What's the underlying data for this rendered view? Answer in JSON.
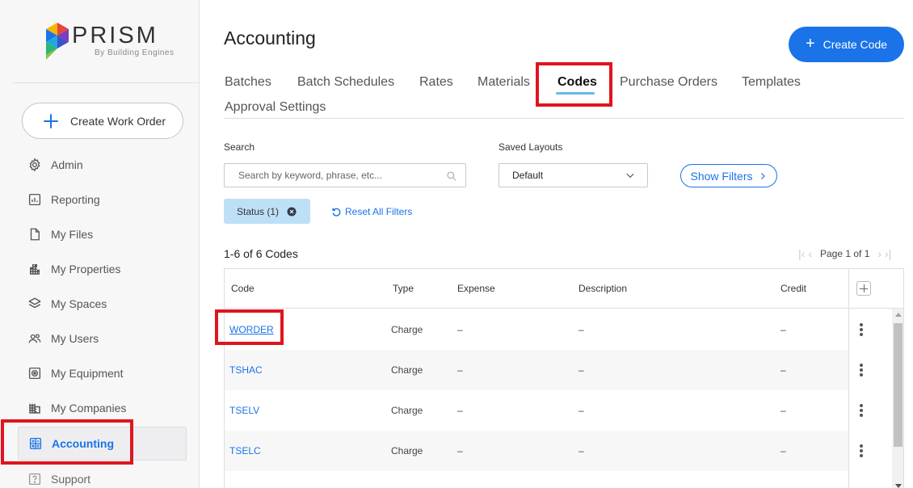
{
  "brand": {
    "name": "PRISM",
    "sub": "By Building Engines"
  },
  "sidebar": {
    "create_label": "Create Work Order",
    "items": [
      {
        "label": "Admin",
        "icon": "gear-icon"
      },
      {
        "label": "Reporting",
        "icon": "report-icon"
      },
      {
        "label": "My Files",
        "icon": "file-icon"
      },
      {
        "label": "My Properties",
        "icon": "building-icon"
      },
      {
        "label": "My Spaces",
        "icon": "layers-icon"
      },
      {
        "label": "My Users",
        "icon": "users-icon"
      },
      {
        "label": "My Equipment",
        "icon": "equipment-icon"
      },
      {
        "label": "My Companies",
        "icon": "companies-icon"
      },
      {
        "label": "Accounting",
        "icon": "calculator-icon",
        "active": true
      },
      {
        "label": "Support",
        "icon": "help-icon"
      }
    ]
  },
  "main": {
    "title": "Accounting",
    "create_label": "Create Code",
    "tabs": [
      "Batches",
      "Batch Schedules",
      "Rates",
      "Materials",
      "Codes",
      "Purchase Orders",
      "Templates",
      "Approval Settings"
    ],
    "active_tab": "Codes",
    "search": {
      "label": "Search",
      "placeholder": "Search by keyword, phrase, etc..."
    },
    "saved_layouts": {
      "label": "Saved Layouts",
      "value": "Default"
    },
    "show_filters_label": "Show Filters",
    "chip_label": "Status (1)",
    "reset_label": "Reset All Filters",
    "count_label": "1-6 of 6 Codes",
    "page_label": "Page 1 of 1",
    "table": {
      "columns": [
        "Code",
        "Type",
        "Expense",
        "Description",
        "Credit"
      ],
      "rows": [
        {
          "code": "WORDER",
          "type": "Charge",
          "expense": "–",
          "description": "–",
          "credit": "–"
        },
        {
          "code": "TSHAC",
          "type": "Charge",
          "expense": "–",
          "description": "–",
          "credit": "–"
        },
        {
          "code": "TSELV",
          "type": "Charge",
          "expense": "–",
          "description": "–",
          "credit": "–"
        },
        {
          "code": "TSELC",
          "type": "Charge",
          "expense": "–",
          "description": "–",
          "credit": "–"
        }
      ]
    }
  },
  "colors": {
    "accent": "#1a73e8",
    "highlight": "#e0141e",
    "chip_bg": "#bde0f7"
  }
}
